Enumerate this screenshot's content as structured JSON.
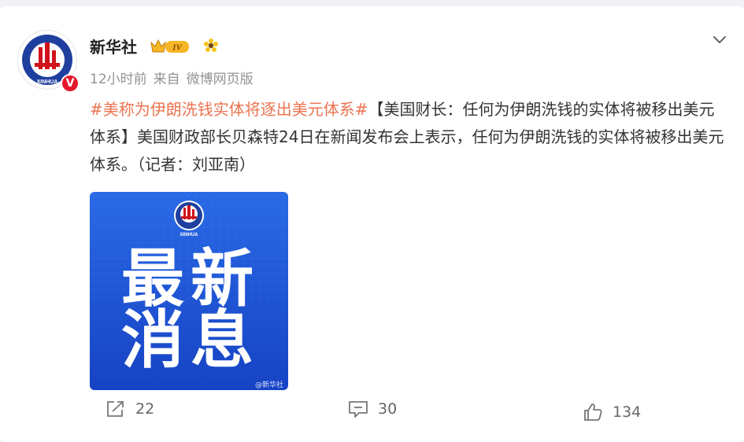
{
  "post": {
    "author": "新华社",
    "badge_level": "IV",
    "time": "12小时前",
    "source_prefix": "来自",
    "source": "微博网页版",
    "hashtag": "#美称为伊朗洗钱实体将逐出美元体系#",
    "body": "【美国财长：任何为伊朗洗钱的实体将被移出美元体系】美国财政部长贝森特24日在新闻发布会上表示，任何为伊朗洗钱的实体将被移出美元体系。（记者：刘亚南）"
  },
  "avatar": {
    "emblem_text": "XINHUA",
    "verified": "V"
  },
  "image": {
    "line1": "最新",
    "line2": "消息",
    "emblem_text": "XINHUA",
    "watermark": "@新华社"
  },
  "stats": {
    "shares": "22",
    "comments": "30",
    "likes": "134"
  },
  "colors": {
    "hashtag": "#eb7350",
    "verified": "#e6162d",
    "image_blue": "#1d54d8",
    "meta": "#939393"
  },
  "icons": {
    "menu": "chevron-down-icon",
    "share": "share-icon",
    "comment": "comment-icon",
    "like": "thumbs-up-icon",
    "badge": "crown-badge-icon",
    "sunflower": "sunflower-icon"
  }
}
